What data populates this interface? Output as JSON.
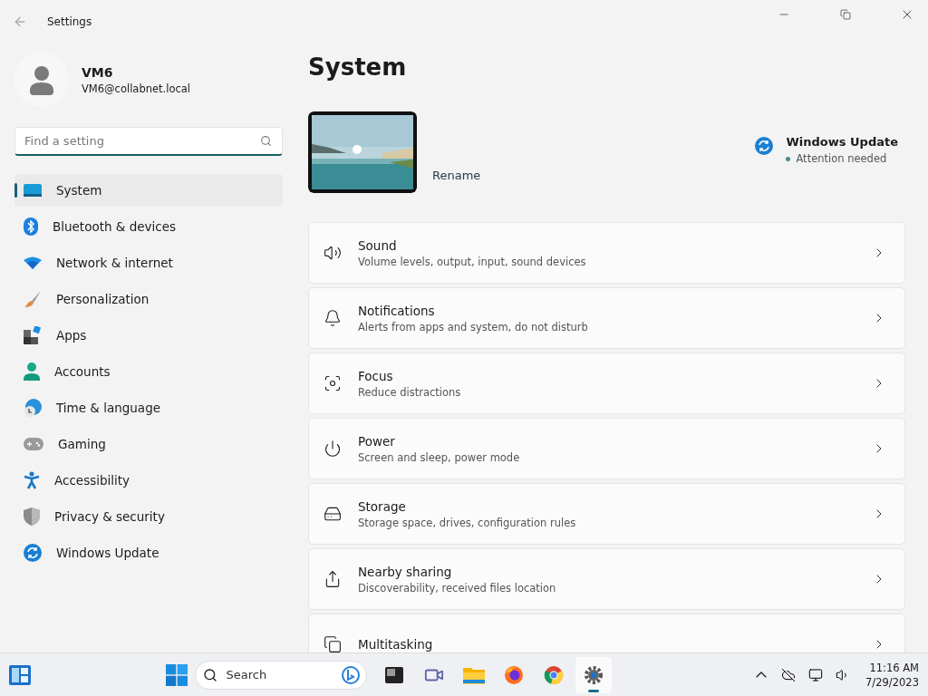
{
  "window": {
    "title": "Settings"
  },
  "user": {
    "name": "VM6",
    "email": "VM6@collabnet.local"
  },
  "search": {
    "placeholder": "Find a setting"
  },
  "sidebar": {
    "items": [
      {
        "label": "System",
        "selected": true
      },
      {
        "label": "Bluetooth & devices",
        "selected": false
      },
      {
        "label": "Network & internet",
        "selected": false
      },
      {
        "label": "Personalization",
        "selected": false
      },
      {
        "label": "Apps",
        "selected": false
      },
      {
        "label": "Accounts",
        "selected": false
      },
      {
        "label": "Time & language",
        "selected": false
      },
      {
        "label": "Gaming",
        "selected": false
      },
      {
        "label": "Accessibility",
        "selected": false
      },
      {
        "label": "Privacy & security",
        "selected": false
      },
      {
        "label": "Windows Update",
        "selected": false
      }
    ]
  },
  "page": {
    "title": "System",
    "rename": "Rename",
    "update": {
      "title": "Windows Update",
      "status": "Attention needed"
    }
  },
  "settings": [
    {
      "title": "Sound",
      "subtitle": "Volume levels, output, input, sound devices"
    },
    {
      "title": "Notifications",
      "subtitle": "Alerts from apps and system, do not disturb"
    },
    {
      "title": "Focus",
      "subtitle": "Reduce distractions"
    },
    {
      "title": "Power",
      "subtitle": "Screen and sleep, power mode"
    },
    {
      "title": "Storage",
      "subtitle": "Storage space, drives, configuration rules"
    },
    {
      "title": "Nearby sharing",
      "subtitle": "Discoverability, received files location"
    },
    {
      "title": "Multitasking"
    }
  ],
  "taskbar": {
    "search": {
      "placeholder": "Search"
    },
    "apps": [
      {
        "selected": false
      },
      {
        "selected": false
      },
      {
        "selected": false
      },
      {
        "selected": false
      },
      {
        "selected": false
      },
      {
        "selected": true
      }
    ],
    "time": "11:16 AM",
    "date": "7/29/2023"
  }
}
